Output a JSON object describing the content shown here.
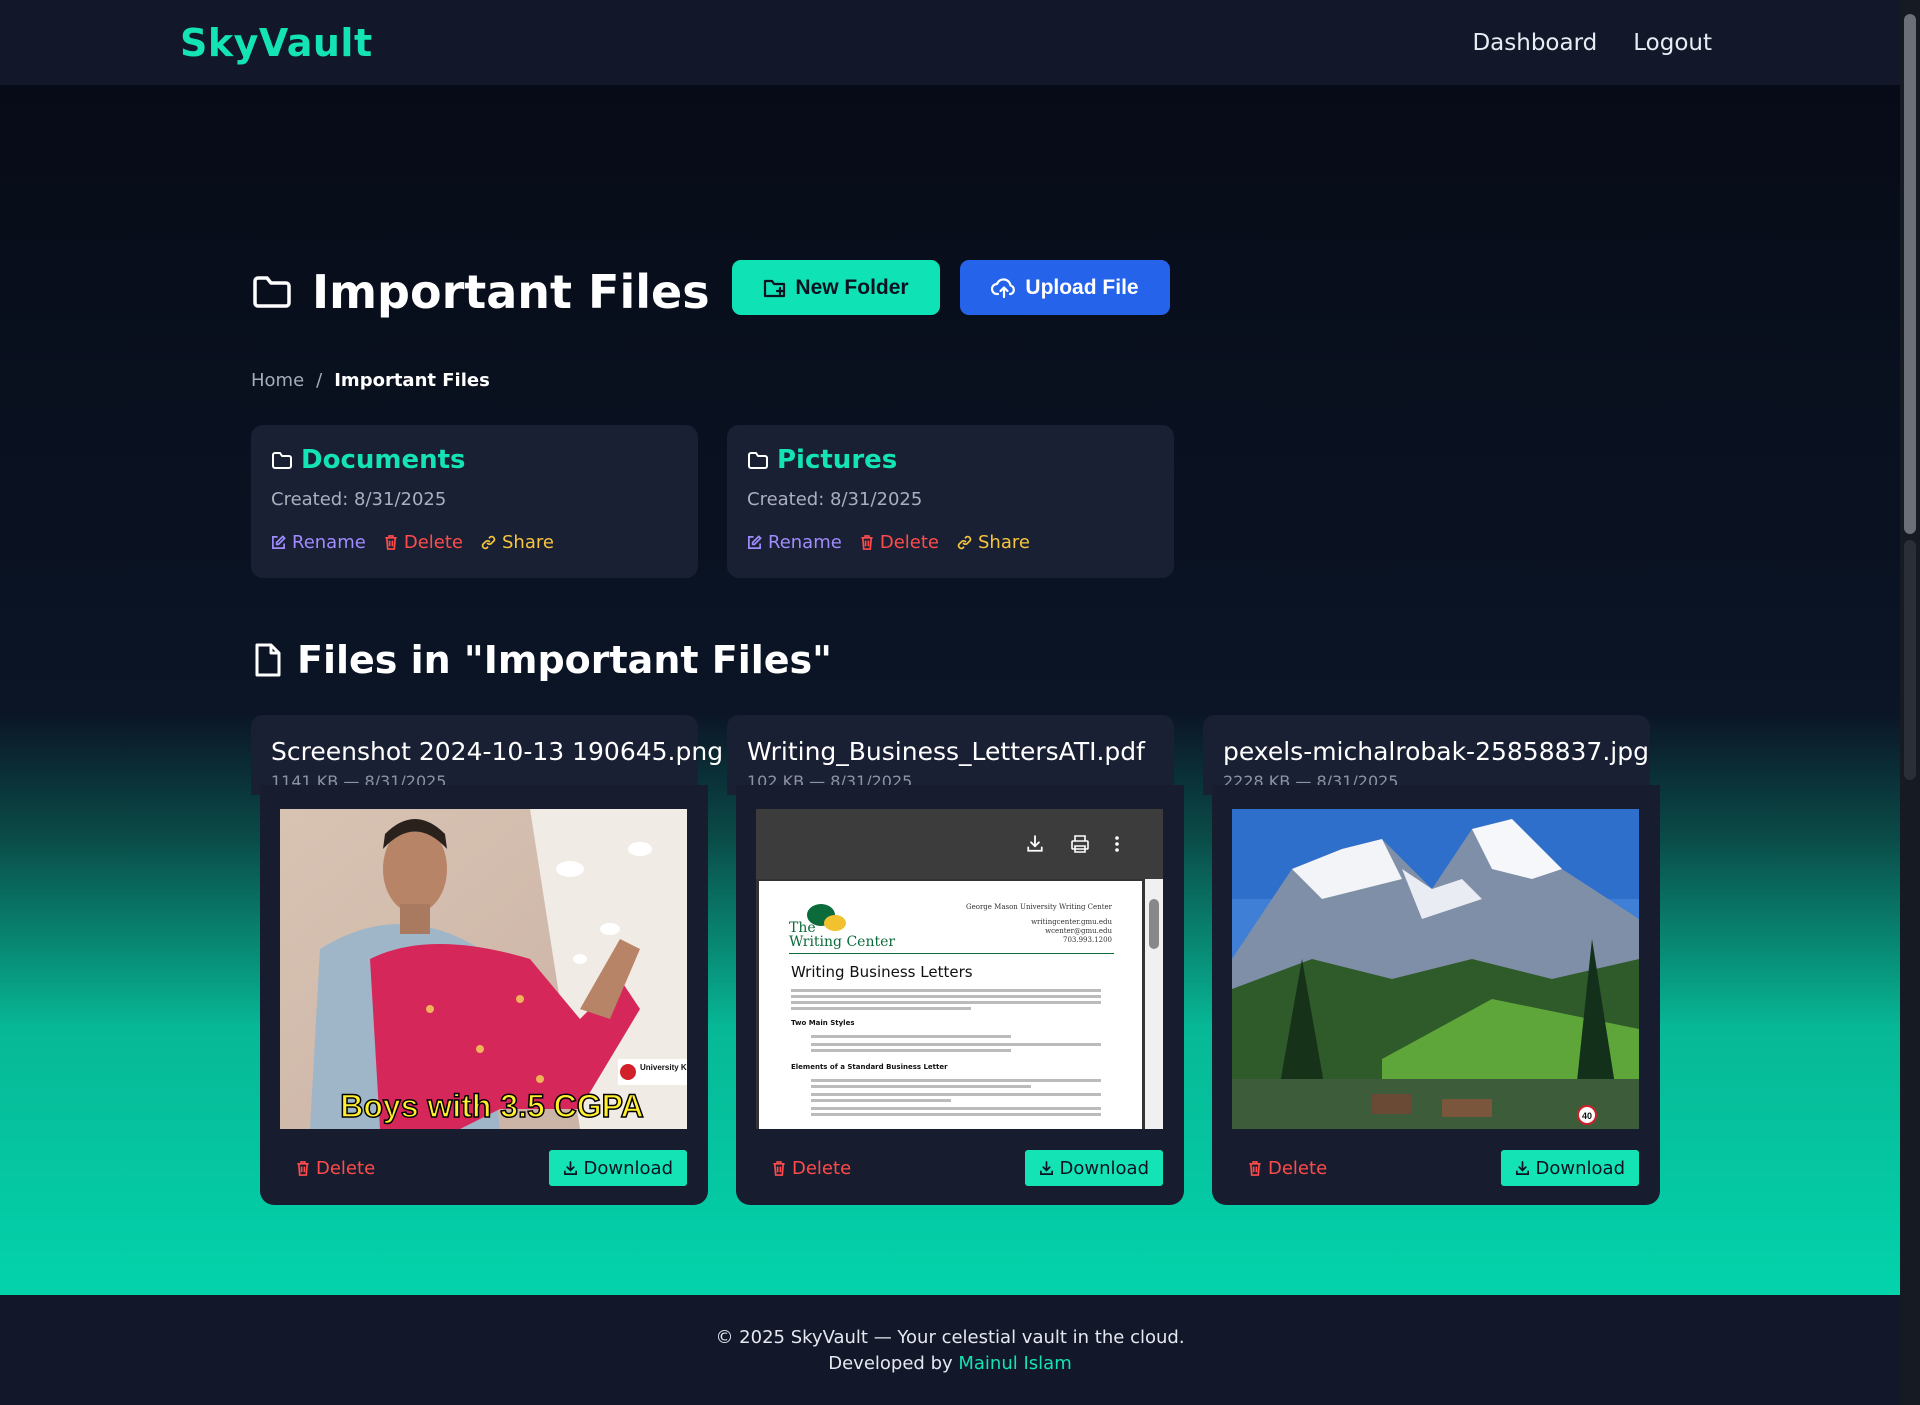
{
  "brand": "SkyVault",
  "nav": {
    "dashboard": "Dashboard",
    "logout": "Logout"
  },
  "toolbar": {
    "new_folder": "New Folder",
    "upload_file": "Upload File"
  },
  "page_title": "Important Files",
  "breadcrumb": {
    "home": "Home",
    "separator": "/",
    "current": "Important Files"
  },
  "folders": [
    {
      "name": "Documents",
      "created": "Created: 8/31/2025",
      "rename": "Rename",
      "delete": "Delete",
      "share": "Share"
    },
    {
      "name": "Pictures",
      "created": "Created: 8/31/2025",
      "rename": "Rename",
      "delete": "Delete",
      "share": "Share"
    }
  ],
  "files_heading": "Files in \"Important Files\"",
  "files": [
    {
      "name": "Screenshot 2024-10-13 190645.png",
      "meta": "1141 KB — 8/31/2025",
      "delete": "Delete",
      "download": "Download",
      "preview_caption": "Boys with 3.5 CGPA",
      "preview_badge": "University Ki M"
    },
    {
      "name": "Writing_Business_LettersATI.pdf",
      "meta": "102 KB — 8/31/2025",
      "delete": "Delete",
      "download": "Download",
      "pdf": {
        "brand_line1": "The",
        "brand_line2": "Writing Center",
        "header_org": "George Mason University Writing Center",
        "header_line2": "writingcenter.gmu.edu",
        "header_line3": "wcenter@gmu.edu",
        "header_line4": "703.993.1200",
        "title": "Writing Business Letters",
        "section1": "Two Main Styles",
        "section2": "Elements of a Standard Business Letter"
      }
    },
    {
      "name": "pexels-michalrobak-25858837.jpg",
      "meta": "2228 KB — 8/31/2025",
      "delete": "Delete",
      "download": "Download",
      "preview_sign": "40"
    }
  ],
  "footer": {
    "line1": "© 2025 SkyVault — Your celestial vault in the cloud.",
    "line2_prefix": "Developed by ",
    "author": "Mainul Islam"
  },
  "colors": {
    "accent": "#14e3b6",
    "upload_button": "#2563eb",
    "delete": "#ff4b4b",
    "rename": "#9f8cff",
    "share": "#f6c53d"
  }
}
